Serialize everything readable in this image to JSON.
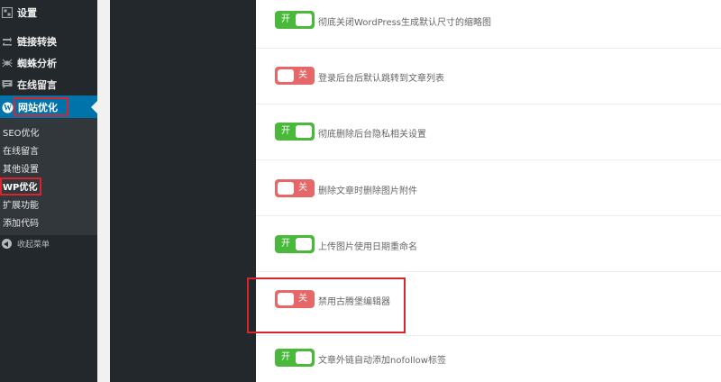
{
  "sidebar": {
    "top_item": {
      "label": "设置",
      "icon": "settings-icon"
    },
    "items": [
      {
        "label": "链接转换",
        "icon": "link-icon"
      },
      {
        "label": "蜘蛛分析",
        "icon": "spider-icon"
      },
      {
        "label": "在线留言",
        "icon": "comment-icon"
      }
    ],
    "active_item": {
      "label": "网站优化",
      "icon": "wordpress-icon"
    },
    "submenu": [
      {
        "label": "SEO优化"
      },
      {
        "label": "在线留言"
      },
      {
        "label": "其他设置"
      },
      {
        "label": "WP优化",
        "current": true
      },
      {
        "label": "扩展功能"
      },
      {
        "label": "添加代码"
      }
    ],
    "collapse_label": "收起菜单"
  },
  "settings": [
    {
      "state": "开",
      "on": true,
      "label": "彻底关闭WordPress生成默认尺寸的缩略图"
    },
    {
      "state": "关",
      "on": false,
      "label": "登录后台后默认跳转到文章列表"
    },
    {
      "state": "开",
      "on": true,
      "label": "彻底删除后台隐私相关设置"
    },
    {
      "state": "关",
      "on": false,
      "label": "删除文章时删除图片附件"
    },
    {
      "state": "开",
      "on": true,
      "label": "上传图片使用日期重命名"
    },
    {
      "state": "关",
      "on": false,
      "label": "禁用古腾堡编辑器"
    },
    {
      "state": "开",
      "on": true,
      "label": "文章外链自动添加nofollow标签"
    }
  ],
  "colors": {
    "sidebar_bg": "#23282d",
    "active_bg": "#0073aa",
    "switch_on": "#4ab93b",
    "switch_off": "#e56767",
    "highlight": "#d9242b"
  }
}
